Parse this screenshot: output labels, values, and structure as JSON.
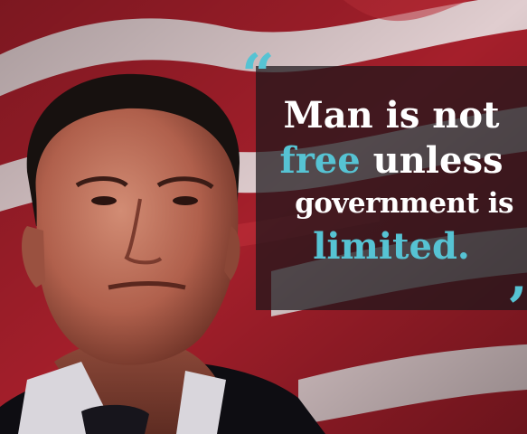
{
  "quote": {
    "open_mark": "“",
    "close_mark": "’",
    "line1": "Man is not",
    "line2_accent": "free",
    "line2_rest": " unless",
    "line3": "government is",
    "line4_accent": "limited."
  },
  "colors": {
    "accent": "#56c3d3",
    "text": "#ffffff",
    "panel": "#1c161a",
    "flag_red": "#b3232f",
    "flag_white": "#e9dfe0",
    "suit": "#0e0d12"
  }
}
